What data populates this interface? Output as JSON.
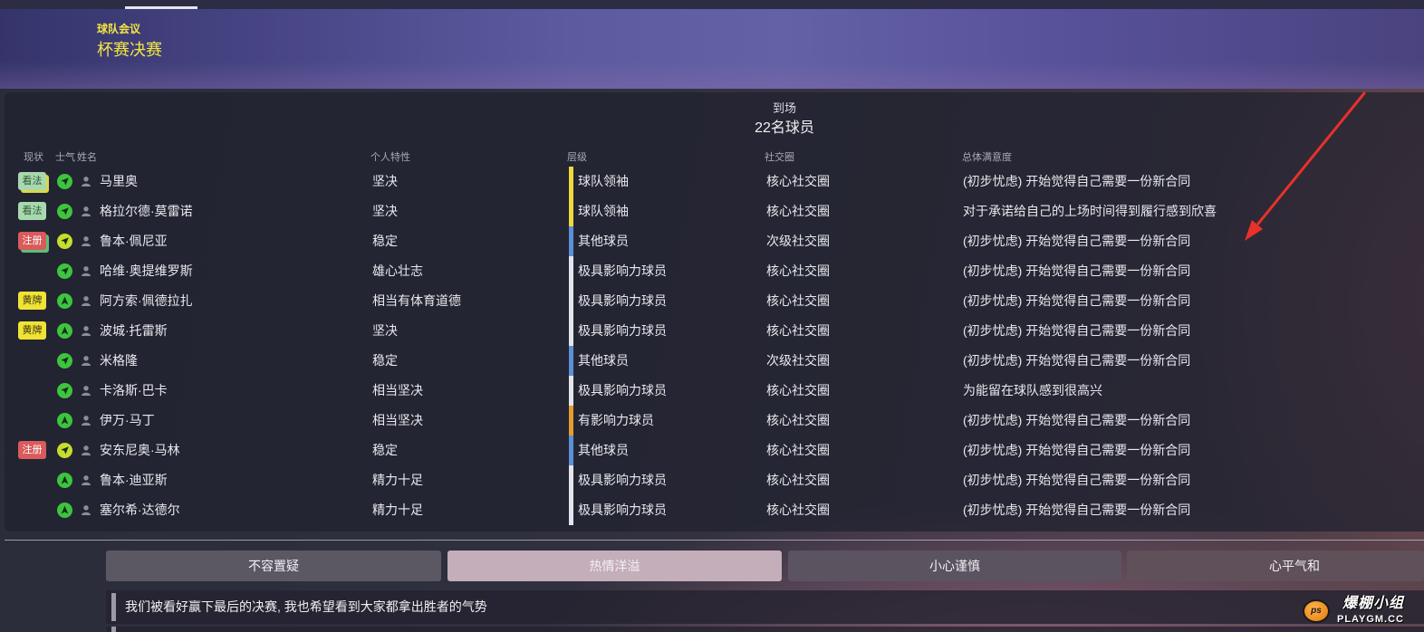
{
  "header": {
    "subtitle": "球队会议",
    "title": "杯赛决赛"
  },
  "attendance": {
    "label": "到场",
    "count": "22名球员"
  },
  "columns": {
    "status": "现状",
    "morale": "士气",
    "name": "姓名",
    "personality": "个人特性",
    "level": "层级",
    "social": "社交圈",
    "satisfaction": "总体满意度"
  },
  "status_styles": {
    "看法": {
      "bg": "#a8d8ae",
      "fg": "#2d5634"
    },
    "注册": {
      "bg": "#d95b5b",
      "fg": "#ffffff"
    },
    "黄牌": {
      "bg": "#f1e334",
      "fg": "#3a3810"
    }
  },
  "players": [
    {
      "status": "看法",
      "status_stack_color": "#d9d84a",
      "morale_icon": "diagonal-arrow",
      "morale_color": "#3ec43e",
      "name": "马里奥",
      "personality": "坚决",
      "level": "球队领袖",
      "level_color": "#f0d93c",
      "social": "核心社交圈",
      "satisfaction": "(初步忧虑) 开始觉得自己需要一份新合同"
    },
    {
      "status": "看法",
      "morale_icon": "diagonal-arrow",
      "morale_color": "#3ec43e",
      "name": "格拉尔德·莫雷诺",
      "personality": "坚决",
      "level": "球队领袖",
      "level_color": "#f0d93c",
      "social": "核心社交圈",
      "satisfaction": "对于承诺给自己的上场时间得到履行感到欣喜"
    },
    {
      "status": "注册",
      "status_stack_color": "#5cbf78",
      "morale_icon": "diagonal-arrow",
      "morale_color": "#c6dc2e",
      "name": "鲁本·佩尼亚",
      "personality": "稳定",
      "level": "其他球员",
      "level_color": "#5b90d6",
      "social": "次级社交圈",
      "satisfaction": "(初步忧虑) 开始觉得自己需要一份新合同"
    },
    {
      "status": "",
      "morale_icon": "diagonal-arrow",
      "morale_color": "#3ec43e",
      "name": "哈维·奥提维罗斯",
      "personality": "雄心壮志",
      "level": "极具影响力球员",
      "level_color": "#e4e4ec",
      "social": "核心社交圈",
      "satisfaction": "(初步忧虑) 开始觉得自己需要一份新合同"
    },
    {
      "status": "黄牌",
      "morale_icon": "up-arrow",
      "morale_color": "#3ec43e",
      "name": "阿方索·佩德拉扎",
      "personality": "相当有体育道德",
      "level": "极具影响力球员",
      "level_color": "#e4e4ec",
      "social": "核心社交圈",
      "satisfaction": "(初步忧虑) 开始觉得自己需要一份新合同"
    },
    {
      "status": "黄牌",
      "morale_icon": "up-arrow",
      "morale_color": "#3ec43e",
      "name": "波城·托雷斯",
      "personality": "坚决",
      "level": "极具影响力球员",
      "level_color": "#e4e4ec",
      "social": "核心社交圈",
      "satisfaction": "(初步忧虑) 开始觉得自己需要一份新合同"
    },
    {
      "status": "",
      "morale_icon": "diagonal-arrow",
      "morale_color": "#3ec43e",
      "name": "米格隆",
      "personality": "稳定",
      "level": "其他球员",
      "level_color": "#5b90d6",
      "social": "次级社交圈",
      "satisfaction": "(初步忧虑) 开始觉得自己需要一份新合同"
    },
    {
      "status": "",
      "morale_icon": "diagonal-arrow",
      "morale_color": "#3ec43e",
      "name": "卡洛斯·巴卡",
      "personality": "相当坚决",
      "level": "极具影响力球员",
      "level_color": "#e4e4ec",
      "social": "核心社交圈",
      "satisfaction": "为能留在球队感到很高兴"
    },
    {
      "status": "",
      "morale_icon": "up-arrow",
      "morale_color": "#3ec43e",
      "name": "伊万·马丁",
      "personality": "相当坚决",
      "level": "有影响力球员",
      "level_color": "#e59b2e",
      "social": "核心社交圈",
      "satisfaction": "(初步忧虑) 开始觉得自己需要一份新合同"
    },
    {
      "status": "注册",
      "morale_icon": "diagonal-arrow",
      "morale_color": "#c6dc2e",
      "name": "安东尼奥·马林",
      "personality": "稳定",
      "level": "其他球员",
      "level_color": "#5b90d6",
      "social": "核心社交圈",
      "satisfaction": "(初步忧虑) 开始觉得自己需要一份新合同"
    },
    {
      "status": "",
      "morale_icon": "up-arrow",
      "morale_color": "#3ec43e",
      "name": "鲁本·迪亚斯",
      "personality": "精力十足",
      "level": "极具影响力球员",
      "level_color": "#e4e4ec",
      "social": "核心社交圈",
      "satisfaction": "(初步忧虑) 开始觉得自己需要一份新合同"
    },
    {
      "status": "",
      "morale_icon": "up-arrow",
      "morale_color": "#3ec43e",
      "name": "塞尔希·达德尔",
      "personality": "精力十足",
      "level": "极具影响力球员",
      "level_color": "#e4e4ec",
      "social": "核心社交圈",
      "satisfaction": "(初步忧虑) 开始觉得自己需要一份新合同"
    }
  ],
  "tones": [
    {
      "label": "不容置疑",
      "bg": "#5c5863"
    },
    {
      "label": "热情洋溢",
      "bg": "#c4aeb9",
      "selected": true
    },
    {
      "label": "小心谨慎",
      "bg": "#5b5360"
    },
    {
      "label": "心平气和",
      "bg": "#5f5059"
    }
  ],
  "statement": "我们被看好赢下最后的决赛, 我也希望看到大家都拿出胜者的气势",
  "watermark": {
    "logo_text": "ps",
    "name": "爆棚小组",
    "site": "PLAYGM.CC"
  },
  "colors": {
    "accent": "#f2e640",
    "annotation_arrow": "#e8312b",
    "avatar": "#8d8d99",
    "morale_arrow": "#14301a"
  }
}
